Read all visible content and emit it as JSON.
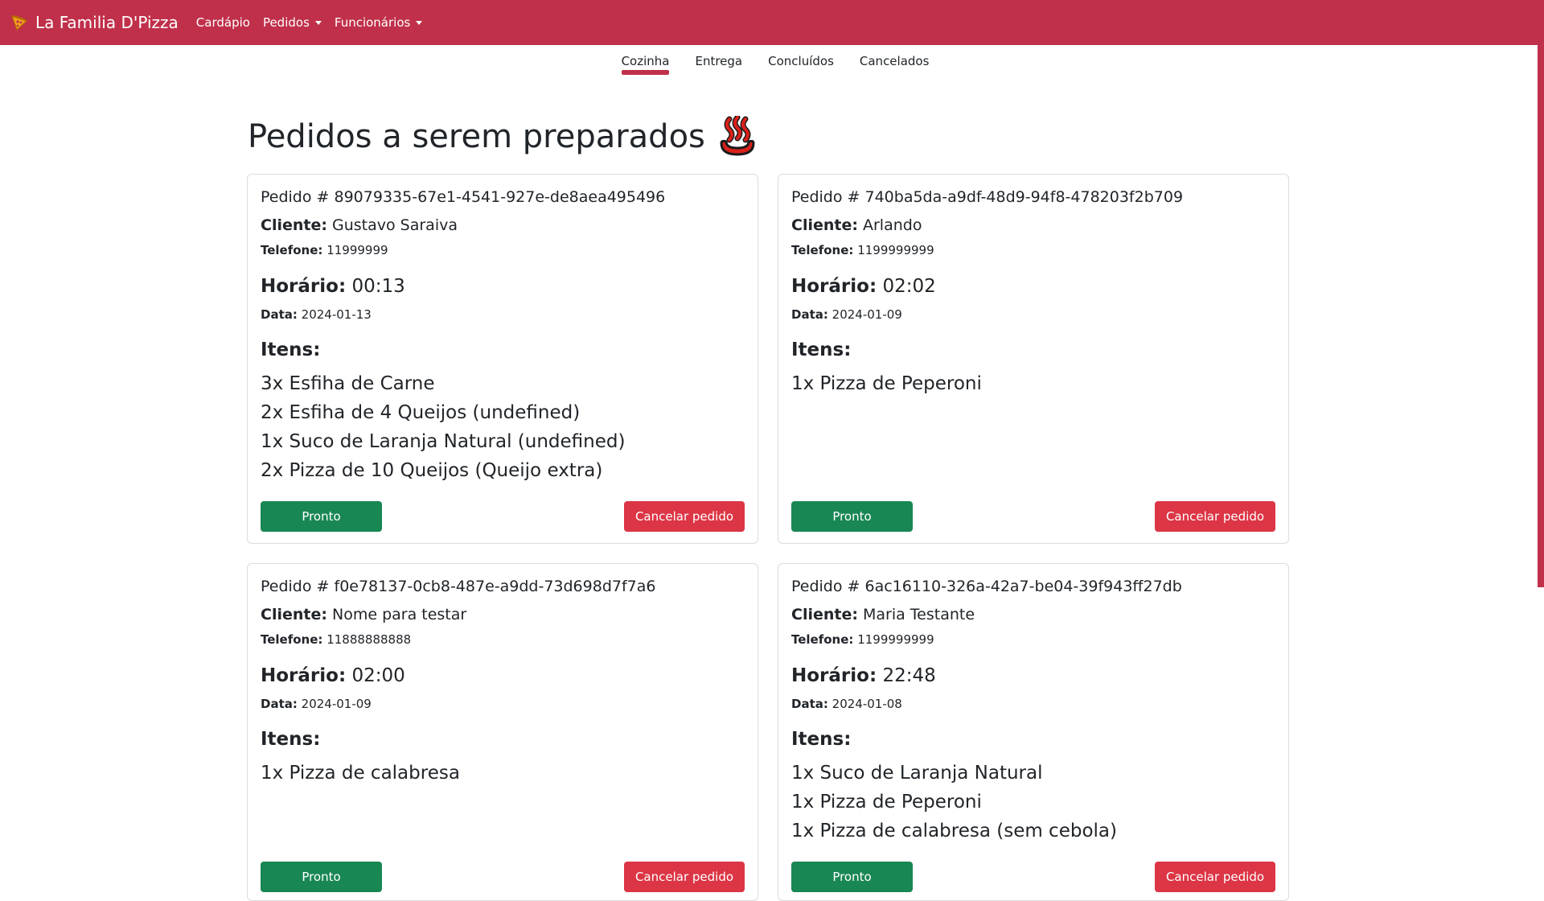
{
  "navbar": {
    "brand": "La Familia D'Pizza",
    "brand_icon": "pizza-slice-icon",
    "links": [
      {
        "label": "Cardápio",
        "dropdown": false
      },
      {
        "label": "Pedidos",
        "dropdown": true
      },
      {
        "label": "Funcionários",
        "dropdown": true
      }
    ],
    "color": "#c0304a"
  },
  "tabs": [
    {
      "label": "Cozinha",
      "active": true
    },
    {
      "label": "Entrega",
      "active": false
    },
    {
      "label": "Concluídos",
      "active": false
    },
    {
      "label": "Cancelados",
      "active": false
    }
  ],
  "page": {
    "title": "Pedidos a serem preparados",
    "title_icon": "hot-springs-steam-icon"
  },
  "labels": {
    "order_prefix": "Pedido # ",
    "client": "Cliente:",
    "phone": "Telefone:",
    "time": "Horário:",
    "date": "Data:",
    "items": "Itens:",
    "ready_button": "Pronto",
    "cancel_button": "Cancelar pedido"
  },
  "orders": [
    {
      "id": "89079335-67e1-4541-927e-de8aea495496",
      "client": "Gustavo Saraiva",
      "phone": "11999999",
      "time": "00:13",
      "date": "2024-01-13",
      "items": [
        "3x Esfiha de Carne",
        "2x Esfiha de 4 Queijos (undefined)",
        "1x Suco de Laranja Natural (undefined)",
        "2x Pizza de 10 Queijos (Queijo extra)"
      ]
    },
    {
      "id": "740ba5da-a9df-48d9-94f8-478203f2b709",
      "client": "Arlando",
      "phone": "1199999999",
      "time": "02:02",
      "date": "2024-01-09",
      "items": [
        "1x Pizza de Peperoni"
      ]
    },
    {
      "id": "f0e78137-0cb8-487e-a9dd-73d698d7f7a6",
      "client": "Nome para testar",
      "phone": "11888888888",
      "time": "02:00",
      "date": "2024-01-09",
      "items": [
        "1x Pizza de calabresa"
      ]
    },
    {
      "id": "6ac16110-326a-42a7-be04-39f943ff27db",
      "client": "Maria Testante",
      "phone": "1199999999",
      "time": "22:48",
      "date": "2024-01-08",
      "items": [
        "1x Suco de Laranja Natural",
        "1x Pizza de Peperoni",
        "1x Pizza de calabresa (sem cebola)"
      ]
    }
  ],
  "colors": {
    "brand": "#c0304a",
    "ready": "#198754",
    "cancel": "#dc3545"
  }
}
